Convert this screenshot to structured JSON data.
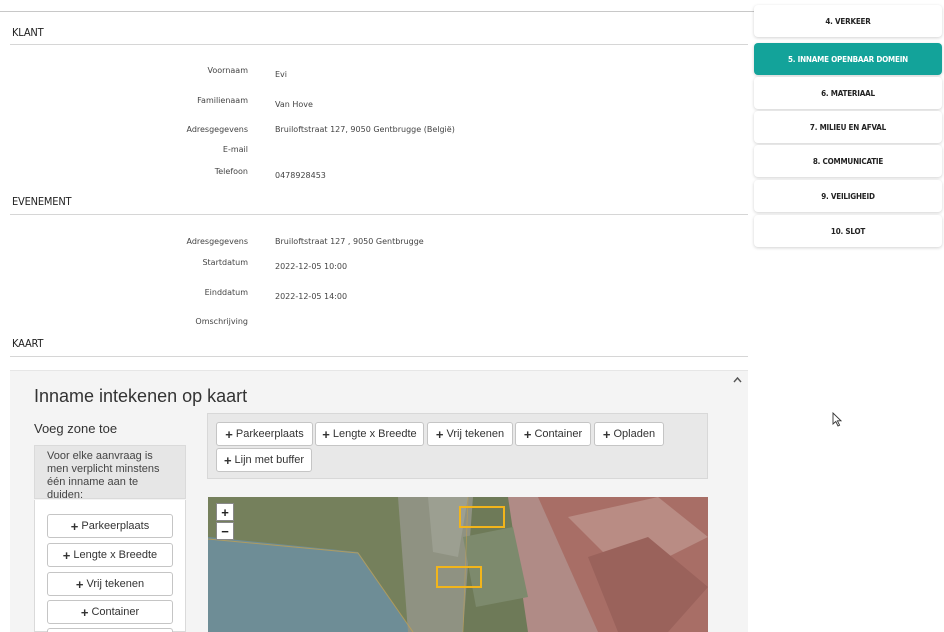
{
  "klant": {
    "title": "KLANT",
    "fields": [
      {
        "label": "Voornaam",
        "value": "Evi"
      },
      {
        "label": "Familienaam",
        "value": "Van Hove"
      },
      {
        "label": "Adresgegevens",
        "value": "Bruiloftstraat 127, 9050 Gentbrugge (België)"
      },
      {
        "label": "E-mail",
        "value": ""
      },
      {
        "label": "Telefoon",
        "value": "0478928453"
      }
    ]
  },
  "evenement": {
    "title": "EVENEMENT",
    "fields": [
      {
        "label": "Adresgegevens",
        "value": "Bruiloftstraat 127 , 9050 Gentbrugge"
      },
      {
        "label": "Startdatum",
        "value": "2022-12-05 10:00"
      },
      {
        "label": "Einddatum",
        "value": "2022-12-05 14:00"
      },
      {
        "label": "Omschrijving",
        "value": ""
      }
    ]
  },
  "kaart": {
    "title": "KAART",
    "panel_title": "Inname intekenen op kaart",
    "voeg_title": "Voeg zone toe",
    "info_text": "Voor elke aanvraag is men verplicht minstens één inname aan te duiden:",
    "toolbar_buttons": [
      "Parkeerplaats",
      "Lengte x Breedte",
      "Vrij tekenen",
      "Container",
      "Opladen",
      "Lijn met buffer"
    ],
    "side_buttons": [
      "Parkeerplaats",
      "Lengte x Breedte",
      "Vrij tekenen",
      "Container"
    ],
    "zoom_in": "+",
    "zoom_out": "−"
  },
  "sidebar": {
    "items": [
      {
        "label": "4. VERKEER",
        "active": false
      },
      {
        "label": "5. INNAME OPENBAAR DOMEIN",
        "active": true
      },
      {
        "label": "6. MATERIAAL",
        "active": false
      },
      {
        "label": "7. MILIEU EN AFVAL",
        "active": false
      },
      {
        "label": "8. COMMUNICATIE",
        "active": false
      },
      {
        "label": "9. VEILIGHEID",
        "active": false
      },
      {
        "label": "10. SLOT",
        "active": false
      }
    ],
    "accent_color": "#13a39a"
  },
  "icons": {
    "plus": "plus-icon",
    "scroll_up": "chevron-up-icon",
    "cursor": "mouse-pointer-icon"
  }
}
